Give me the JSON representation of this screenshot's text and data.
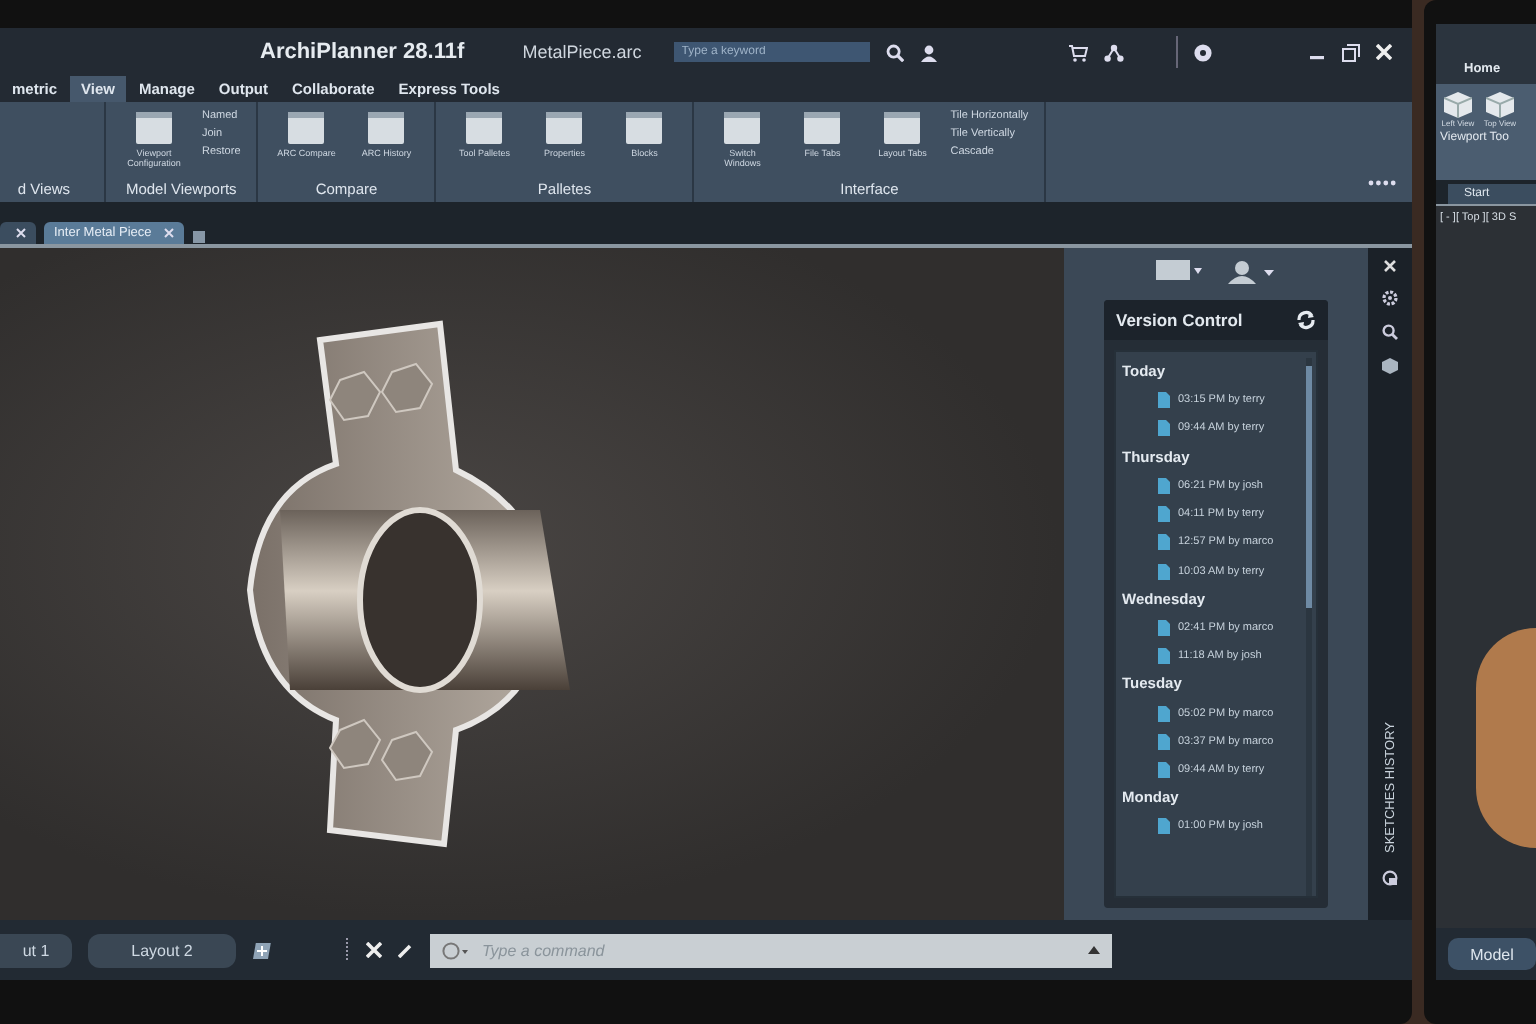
{
  "title_bar": {
    "title": "ArchiPlanner 28.11f",
    "file_name": "MetalPiece.arc",
    "search": {
      "placeholder": "Type a keyword"
    }
  },
  "ribbon_tabs": [
    {
      "label": "metric",
      "selected": false
    },
    {
      "label": "View",
      "selected": true
    },
    {
      "label": "Manage",
      "selected": false
    },
    {
      "label": "Output",
      "selected": false
    },
    {
      "label": "Collaborate",
      "selected": false
    },
    {
      "label": "Express Tools",
      "selected": false
    }
  ],
  "ribbon_groups": [
    {
      "label": "d Views"
    },
    {
      "label": "Model Viewports",
      "tools": [
        {
          "label": "Viewport Configuration",
          "kind": "large"
        },
        {
          "label": "Named",
          "kind": "small"
        },
        {
          "label": "Join",
          "kind": "small"
        },
        {
          "label": "Restore",
          "kind": "small"
        }
      ]
    },
    {
      "label": "Compare",
      "tools": [
        {
          "label": "ARC Compare",
          "kind": "large"
        },
        {
          "label": "ARC History",
          "kind": "large"
        }
      ]
    },
    {
      "label": "Palletes",
      "tools": [
        {
          "label": "Tool Palletes",
          "kind": "large"
        },
        {
          "label": "Properties",
          "kind": "large"
        },
        {
          "label": "Blocks",
          "kind": "large"
        }
      ]
    },
    {
      "label": "Interface",
      "tools": [
        {
          "label": "Switch Windows",
          "kind": "large"
        },
        {
          "label": "File Tabs",
          "kind": "large"
        },
        {
          "label": "Layout Tabs",
          "kind": "large"
        },
        {
          "label": "Tile Horizontally",
          "kind": "small"
        },
        {
          "label": "Tile Vertically",
          "kind": "small"
        },
        {
          "label": "Cascade",
          "kind": "small"
        }
      ]
    }
  ],
  "file_tabs": [
    {
      "selected": false
    },
    {
      "label": "Inter Metal Piece",
      "selected": true
    }
  ],
  "version_control": {
    "title": "Version Control",
    "groups": [
      {
        "day": "Today",
        "entries": [
          "03:15 PM by terry",
          "09:44 AM by terry"
        ]
      },
      {
        "day": "Thursday",
        "entries": [
          "06:21 PM by josh",
          "04:11 PM by terry",
          "12:57 PM by marco",
          "10:03 AM by terry"
        ]
      },
      {
        "day": "Wednesday",
        "entries": [
          "02:41 PM by marco",
          "11:18 AM by josh"
        ]
      },
      {
        "day": "Tuesday",
        "entries": [
          "05:02 PM by marco",
          "03:37 PM by marco",
          "09:44 AM by terry"
        ]
      },
      {
        "day": "Monday",
        "entries": [
          "01:00 PM by josh"
        ]
      }
    ]
  },
  "side_tab": "SKETCHES HISTORY",
  "layout_tabs": [
    {
      "label": "ut 1",
      "selected": false
    },
    {
      "label": "Layout 2",
      "selected": false
    }
  ],
  "command_line": {
    "placeholder": "Type a command"
  },
  "second_monitor": {
    "ribbon_tab": "Home",
    "tools": [
      "Left View",
      "Top View"
    ],
    "group": "Viewport Too",
    "file_tab": "Start",
    "viewport_label": "[ - ][ Top ][ 3D S",
    "layout_tab": "Model"
  }
}
